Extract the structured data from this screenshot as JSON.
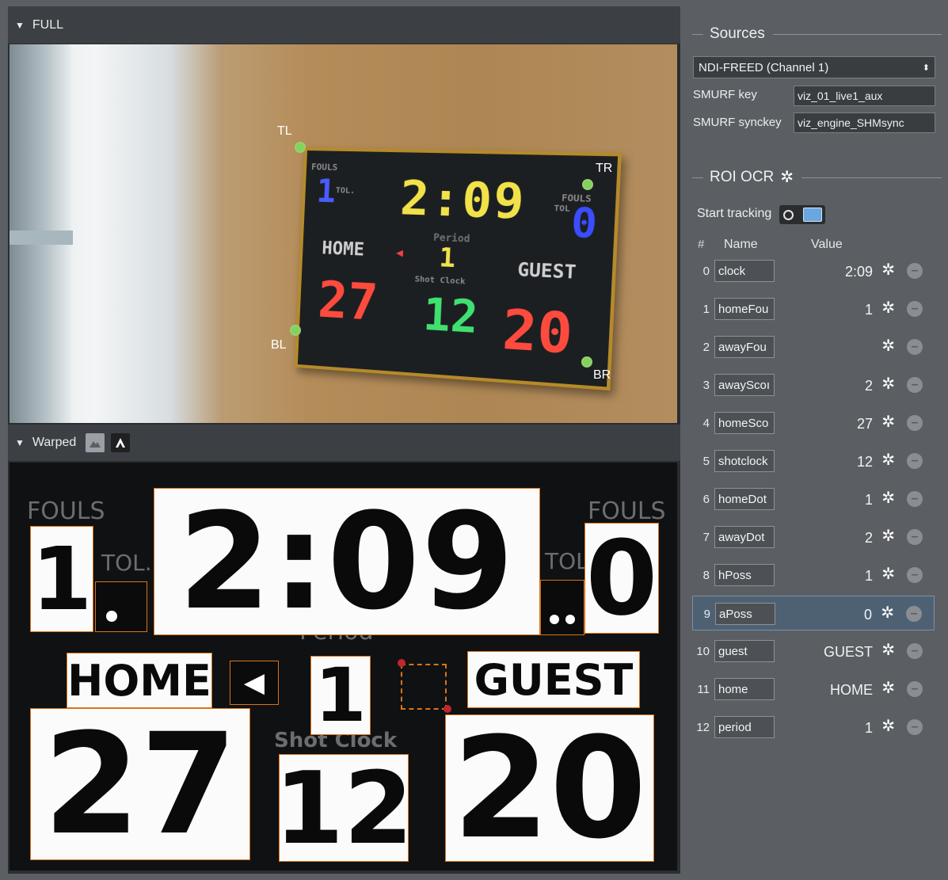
{
  "panels": {
    "full": {
      "title": "FULL"
    },
    "warped": {
      "title": "Warped"
    }
  },
  "camera": {
    "corners": [
      "TL",
      "TR",
      "BL",
      "BR"
    ],
    "scoreboard": {
      "fouls_label_left": "FOULS",
      "fouls_label_right": "FOULS",
      "tol_left": "TOL.",
      "tol_right": "TOL",
      "clock": "2:09",
      "home_fouls": "1",
      "guest_fouls": "0",
      "period_label": "Period",
      "period": "1",
      "home_label": "HOME",
      "guest_label": "GUEST",
      "shot_clock_label": "Shot Clock",
      "home_score": "27",
      "guest_score": "20",
      "shot_clock": "12"
    }
  },
  "warp": {
    "fouls_left": "FOULS",
    "fouls_right": "FOULS",
    "tol_left": "TOL.",
    "tol_right": "TOL",
    "clock": "2:09",
    "home_fouls": "1",
    "guest_fouls": "0",
    "period_label": "Period",
    "period": "1",
    "home": "HOME",
    "guest": "GUEST",
    "shot_clock_label": "Shot Clock",
    "home_score": "27",
    "guest_score": "20",
    "shot_clock": "12"
  },
  "sources": {
    "title": "Sources",
    "selected": "NDI-FREED (Channel 1)",
    "smurf_key_label": "SMURF key",
    "smurf_key": "viz_01_live1_aux",
    "smurf_synckey_label": "SMURF synckey",
    "smurf_synckey": "viz_engine_SHMsync"
  },
  "roi": {
    "title": "ROI OCR",
    "start_tracking": "Start tracking",
    "col_index": "#",
    "col_name": "Name",
    "col_value": "Value",
    "rows": [
      {
        "idx": "0",
        "name": "clock",
        "value": "2:09"
      },
      {
        "idx": "1",
        "name": "homeFou",
        "value": "1"
      },
      {
        "idx": "2",
        "name": "awayFou",
        "value": ""
      },
      {
        "idx": "3",
        "name": "awayScoı",
        "value": "2"
      },
      {
        "idx": "4",
        "name": "homeSco",
        "value": "27"
      },
      {
        "idx": "5",
        "name": "shotclock",
        "value": "12"
      },
      {
        "idx": "6",
        "name": "homeDot",
        "value": "1"
      },
      {
        "idx": "7",
        "name": "awayDot",
        "value": "2"
      },
      {
        "idx": "8",
        "name": "hPoss",
        "value": "1"
      },
      {
        "idx": "9",
        "name": "aPoss",
        "value": "0"
      },
      {
        "idx": "10",
        "name": "guest",
        "value": "GUEST"
      },
      {
        "idx": "11",
        "name": "home",
        "value": "HOME"
      },
      {
        "idx": "12",
        "name": "period",
        "value": "1"
      }
    ],
    "selected_row": "9"
  }
}
